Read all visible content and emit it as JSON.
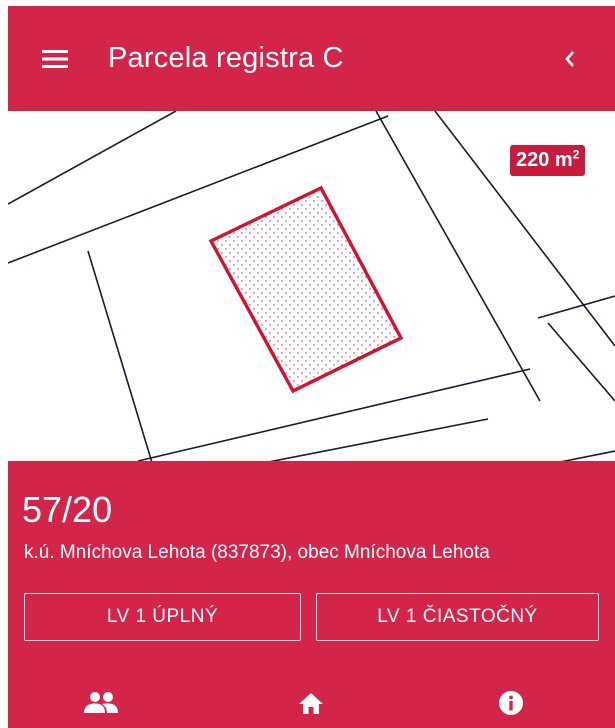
{
  "header": {
    "title": "Parcela registra C",
    "menu_icon": "hamburger-menu-icon",
    "back_icon": "chevron-left-icon"
  },
  "map": {
    "area_value": "220 m",
    "area_unit_sup": "2"
  },
  "parcel": {
    "number": "57/20",
    "location": "k.ú. Mníchova Lehota (837873), obec Mníchova Lehota"
  },
  "buttons": {
    "full_label": "LV 1 ÚPLNÝ",
    "partial_label": "LV 1 ČIASTOČNÝ"
  },
  "bottom_nav": {
    "items": [
      {
        "icon": "people-icon"
      },
      {
        "icon": "home-icon"
      },
      {
        "icon": "info-icon"
      }
    ]
  },
  "colors": {
    "primary": "#d32549",
    "badge": "#c81c3f",
    "parcel_outline": "#d1132f",
    "map_lines": "#1a1a2e"
  }
}
